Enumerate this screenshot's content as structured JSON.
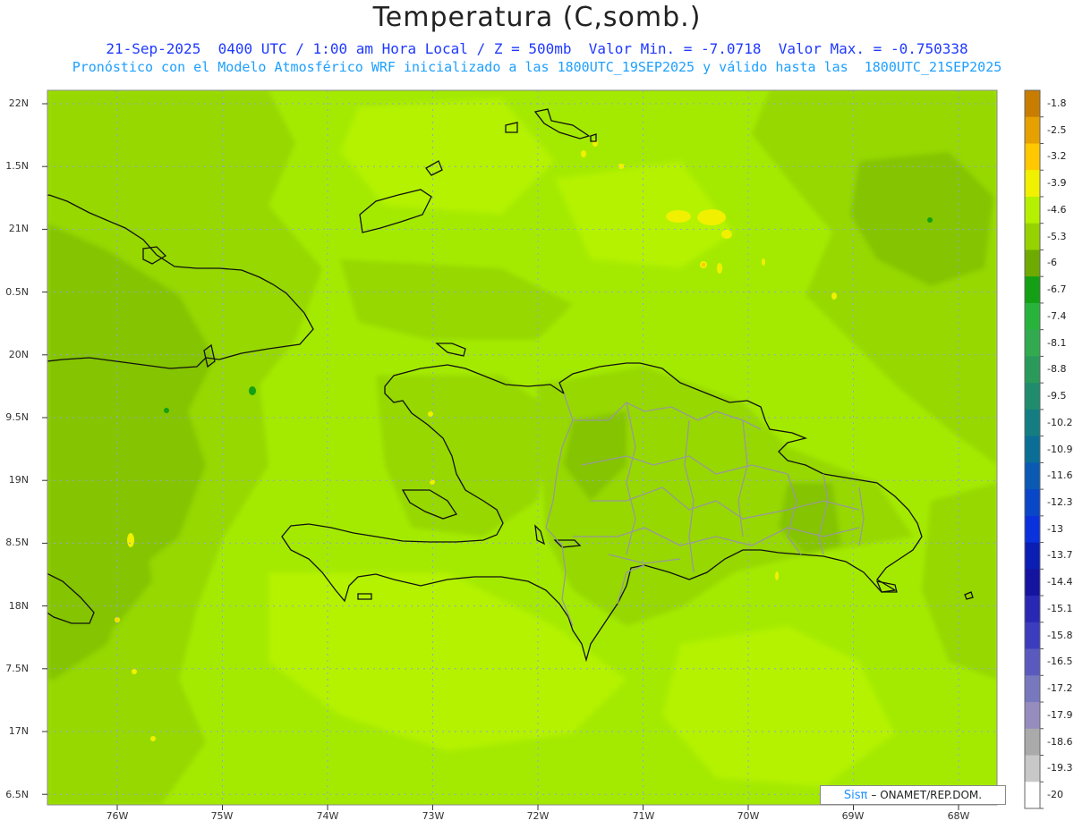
{
  "title": "Temperatura (C,somb.)",
  "subtitle_line1": "21-Sep-2025  0400 UTC / 1:00 am Hora Local / Z = 500mb  Valor Min. = -7.0718  Valor Max. = -0.750338",
  "subtitle_line2": "Pronóstico con el Modelo Atmosférico WRF inicializado a las 1800UTC_19SEP2025 y válido hasta las  1800UTC_21SEP2025",
  "lat_labels": [
    "22N",
    "1.5N",
    "21N",
    "0.5N",
    "20N",
    "9.5N",
    "19N",
    "8.5N",
    "18N",
    "7.5N",
    "17N",
    "6.5N"
  ],
  "lon_labels": [
    "76W",
    "75W",
    "74W",
    "73W",
    "72W",
    "71W",
    "70W",
    "69W",
    "68W"
  ],
  "colorbar": {
    "labels": [
      "-1.8",
      "-2.5",
      "-3.2",
      "-3.9",
      "-4.6",
      "-5.3",
      "-6",
      "-6.7",
      "-7.4",
      "-8.1",
      "-8.8",
      "-9.5",
      "-10.2",
      "-10.9",
      "-11.6",
      "-12.3",
      "-13",
      "-13.7",
      "-14.4",
      "-15.1",
      "-15.8",
      "-16.5",
      "-17.2",
      "-17.9",
      "-18.6",
      "-19.3",
      "-20"
    ],
    "colors": [
      "#c87d00",
      "#e6a000",
      "#ffc800",
      "#f0f000",
      "#b4f000",
      "#96d200",
      "#6eaa00",
      "#14a014",
      "#28b43c",
      "#32aa50",
      "#2a9a5a",
      "#1f8c6e",
      "#147d82",
      "#0a6e96",
      "#0a5ab4",
      "#0a46c8",
      "#0a32dc",
      "#0a1eb4",
      "#1414a0",
      "#2828b4",
      "#3c3cbe",
      "#5a5abe",
      "#7878be",
      "#968cbe",
      "#aaaaaa",
      "#c8c8c8",
      "#ffffff"
    ]
  },
  "field_colors": {
    "base": "#a4ea00",
    "light": "#b4f200",
    "mid": "#96d800",
    "dark": "#84c400",
    "warm": "#f0f000",
    "hot": "#ffc800"
  },
  "credit": {
    "brand": "Sisπ",
    "text": "– ONAMET/REP.DOM."
  }
}
